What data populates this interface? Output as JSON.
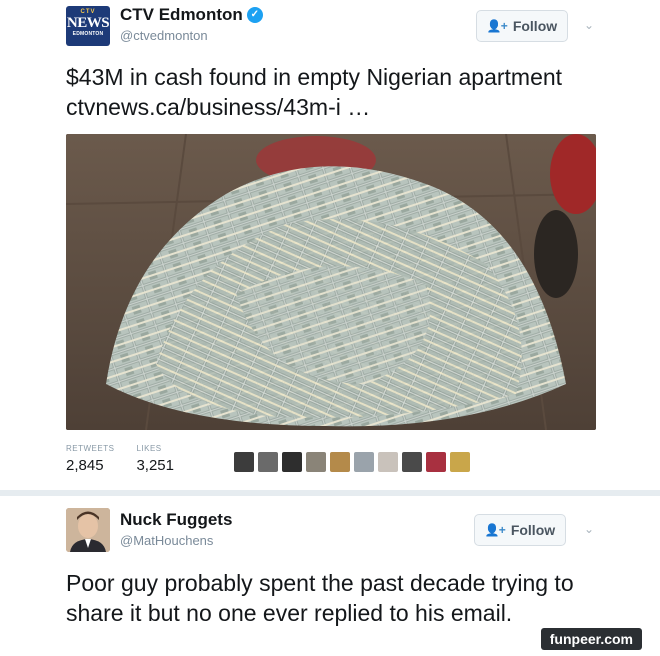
{
  "tweets": [
    {
      "author": {
        "name": "CTV Edmonton",
        "handle": "@ctvedmonton",
        "verified": true,
        "avatar": {
          "dots": "CTV",
          "brand": "NEWS",
          "city": "EDMONTON"
        }
      },
      "follow_label": "Follow",
      "text": "$43M in cash found in empty Nigerian apartment ctvnews.ca/business/43m-i …",
      "photo_alt": "pile of banknote bundles",
      "stats": {
        "retweets_label": "RETWEETS",
        "retweets_value": "2,845",
        "likes_label": "LIKES",
        "likes_value": "3,251"
      },
      "likers_count": 10
    },
    {
      "author": {
        "name": "Nuck Fuggets",
        "handle": "@MatHouchens",
        "verified": false
      },
      "follow_label": "Follow",
      "text": "Poor guy probably spent the past decade trying to share it but no one ever replied to his email."
    }
  ],
  "watermark": "funpeer.com",
  "colors": {
    "verified_badge": "#1da1f2",
    "follow_icon": "#3b89c9",
    "divider": "#e6ecf0"
  },
  "icons": [
    "verified-icon",
    "follow-person-icon",
    "chevron-down-icon"
  ]
}
